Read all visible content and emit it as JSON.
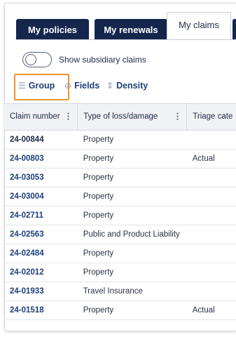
{
  "tabs": [
    {
      "label": "My policies",
      "active": false
    },
    {
      "label": "My renewals",
      "active": false
    },
    {
      "label": "My claims",
      "active": true
    }
  ],
  "toggle": {
    "label": "Show subsidiary claims",
    "checked": false
  },
  "toolbar": {
    "group_label": "Group",
    "fields_label": "Fields",
    "density_label": "Density",
    "icons": {
      "group": "group-lines-icon",
      "fields": "hidden-eye-icon",
      "density": "density-arrows-icon"
    },
    "highlight_color": "#f0952b"
  },
  "table": {
    "headers": [
      "Claim number",
      "Type of loss/damage",
      "Triage cate"
    ],
    "rows": [
      {
        "claim": "24-00844",
        "type": "Property",
        "triage": ""
      },
      {
        "claim": "24-00803",
        "type": "Property",
        "triage": "Actual"
      },
      {
        "claim": "24-03053",
        "type": "Property",
        "triage": ""
      },
      {
        "claim": "24-03004",
        "type": "Property",
        "triage": ""
      },
      {
        "claim": "24-02711",
        "type": "Property",
        "triage": ""
      },
      {
        "claim": "24-02563",
        "type": "Public and Product Liability",
        "triage": ""
      },
      {
        "claim": "24-02484",
        "type": "Property",
        "triage": ""
      },
      {
        "claim": "24-02012",
        "type": "Property",
        "triage": ""
      },
      {
        "claim": "24-01933",
        "type": "Travel Insurance",
        "triage": ""
      },
      {
        "claim": "24-01518",
        "type": "Property",
        "triage": "Actual"
      }
    ]
  }
}
